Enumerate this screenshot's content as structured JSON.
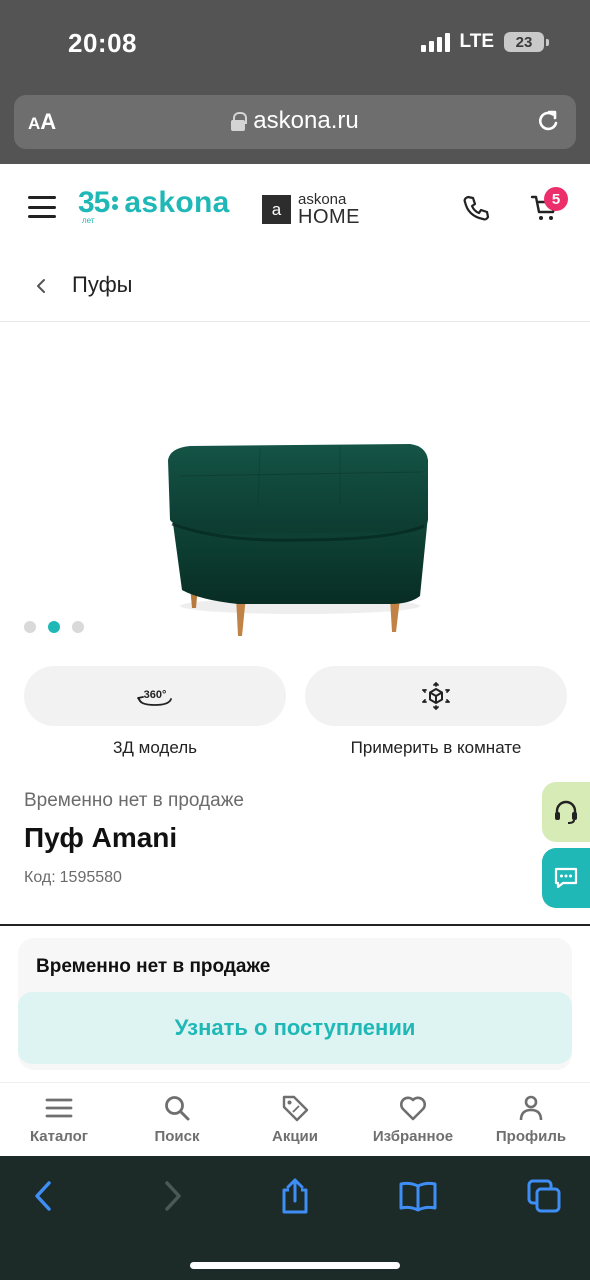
{
  "status_bar": {
    "time": "20:08",
    "network": "LTE",
    "battery": "23"
  },
  "browser": {
    "aa_label": "AA",
    "url": "askona.ru"
  },
  "header": {
    "logo_number": "35",
    "logo_sub": "лет",
    "logo_word": "askona",
    "home_logo_mark": "a",
    "home_logo_line1": "askona",
    "home_logo_line2": "HOME",
    "cart_count": "5"
  },
  "breadcrumb": {
    "label": "Пуфы"
  },
  "gallery": {
    "slide_count": 3,
    "active_slide": 2
  },
  "actions": {
    "model_3d_badge": "360°",
    "model_3d_label": "3Д модель",
    "room_label": "Примерить в комнате"
  },
  "product": {
    "status": "Временно нет в продаже",
    "title": "Пуф Amani",
    "code_label": "Код:",
    "code": "1595580"
  },
  "sale_card": {
    "title": "Временно нет в продаже",
    "notify_button": "Узнать о поступлении"
  },
  "bottom_nav": [
    {
      "label": "Каталог",
      "icon": "menu-icon"
    },
    {
      "label": "Поиск",
      "icon": "search-icon"
    },
    {
      "label": "Акции",
      "icon": "tag-icon"
    },
    {
      "label": "Избранное",
      "icon": "heart-icon"
    },
    {
      "label": "Профиль",
      "icon": "user-icon"
    }
  ],
  "colors": {
    "accent": "#1fb8b6",
    "badge": "#ec2f6b",
    "ottoman": "#0d3b30",
    "support_bg": "#d6ebb6"
  }
}
